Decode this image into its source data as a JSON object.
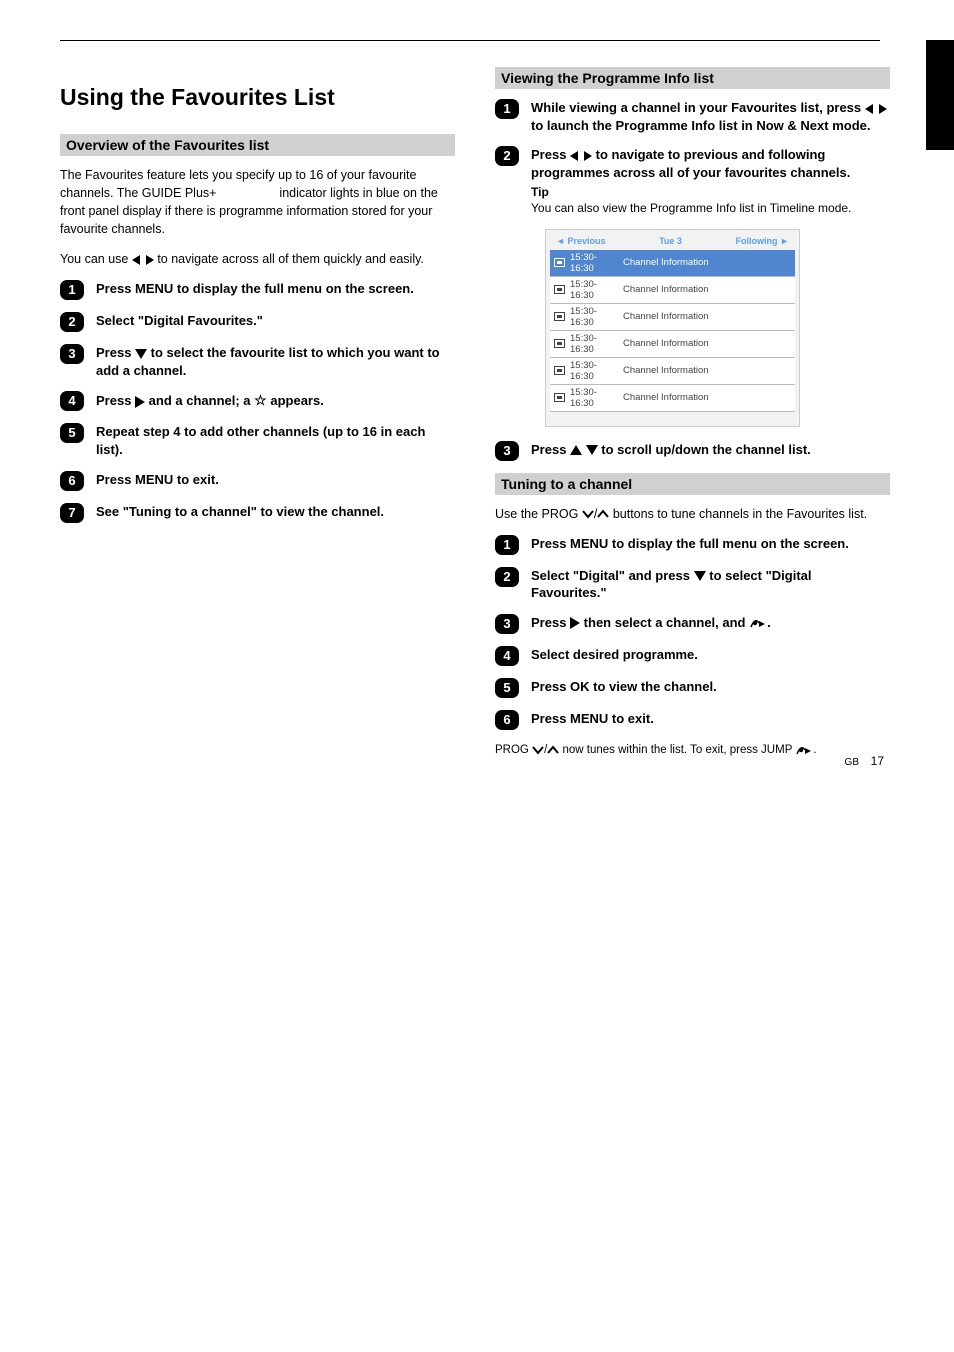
{
  "left": {
    "title": "Using the Favourites List",
    "section": "Overview of the Favourites list",
    "intro_a": "The Favourites feature lets you specify up to 16 of your favourite channels. The GUIDE Plus+",
    "intro_b": "indicator lights in blue on the front panel display if there is programme information stored for your favourite channels.",
    "lr_note": "You can use",
    "lr_note_after": "to navigate across all of them quickly and easily.",
    "steps": {
      "1": "Press MENU to display the full menu on the screen.",
      "2": "Select \"Digital Favourites.\"",
      "3_a": "Press",
      "3_b": "to select the favourite list to which you want to add a channel.",
      "4_a": "Press",
      "4_b": "and a channel; a",
      "4_c": "appears.",
      "5": "Repeat step 4 to add other channels (up to 16 in each list).",
      "6": "Press MENU to exit.",
      "7": "See \"Tuning to a channel\" to view the channel."
    }
  },
  "right": {
    "section1": "Viewing the Programme Info list",
    "s1": {
      "1_a": "While viewing a channel in your Favourites list, press",
      "1_b": "to launch the Programme Info list in Now & Next mode.",
      "2_a": "Press",
      "2_b": "to navigate to previous and following programmes across all of your favourites channels.",
      "tip": "Tip",
      "tip_text": "You can also view the Programme Info list in Timeline mode.",
      "3_a": "Press",
      "3_b": "to scroll up/down the channel list."
    },
    "mock": {
      "prev": "Previous",
      "dow": "Tue 3",
      "next": "Following",
      "rows": [
        {
          "time": "15:30-16:30",
          "title": "Channel Information"
        },
        {
          "time": "15:30-16:30",
          "title": "Channel Information"
        },
        {
          "time": "15:30-16:30",
          "title": "Channel Information"
        },
        {
          "time": "15:30-16:30",
          "title": "Channel Information"
        },
        {
          "time": "15:30-16:30",
          "title": "Channel Information"
        },
        {
          "time": "15:30-16:30",
          "title": "Channel Information"
        }
      ]
    },
    "section2": "Tuning to a channel",
    "s2": {
      "intro": "Use the PROG",
      "intro2": "buttons to tune channels in the Favourites list.",
      "1": "Press MENU to display the full menu on the screen.",
      "2_a": "Select \"Digital\" and press",
      "2_b": "to select \"Digital Favourites.\"",
      "3_a": "Press",
      "3_b": "then select a channel, and",
      "4": "Select desired programme.",
      "5": "Press OK to view the channel.",
      "6": "Press MENU to exit.",
      "footnote_a": "PROG",
      "footnote_b": "now tunes within the list. To exit, press JUMP",
      "footnote_c": "."
    }
  },
  "page": {
    "label": "GB",
    "num": "17"
  }
}
